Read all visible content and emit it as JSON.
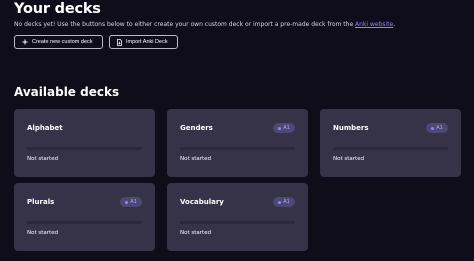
{
  "page": {
    "title": "Your decks",
    "intro_text": "No decks yet! Use the buttons below to either create your own custom deck or import a pre-made deck from the ",
    "intro_link": "Anki website",
    "intro_end": ".",
    "create_button": "Create new custom deck",
    "import_button": "Import Anki Deck",
    "available_title": "Available decks"
  },
  "decks": [
    {
      "name": "Alphabet",
      "level": "",
      "status": "Not started",
      "progress": 0
    },
    {
      "name": "Genders",
      "level": "A1",
      "status": "Not started",
      "progress": 0
    },
    {
      "name": "Numbers",
      "level": "A1",
      "status": "Not started",
      "progress": 0
    },
    {
      "name": "Plurals",
      "level": "A1",
      "status": "Not started",
      "progress": 0
    },
    {
      "name": "Vocabulary",
      "level": "A1",
      "status": "Not started",
      "progress": 0
    }
  ],
  "icons": {
    "create": "plus-icon",
    "import": "file-import-icon"
  },
  "colors": {
    "background": "#0f0d19",
    "card": "#363349",
    "accent": "#8f86ff"
  }
}
